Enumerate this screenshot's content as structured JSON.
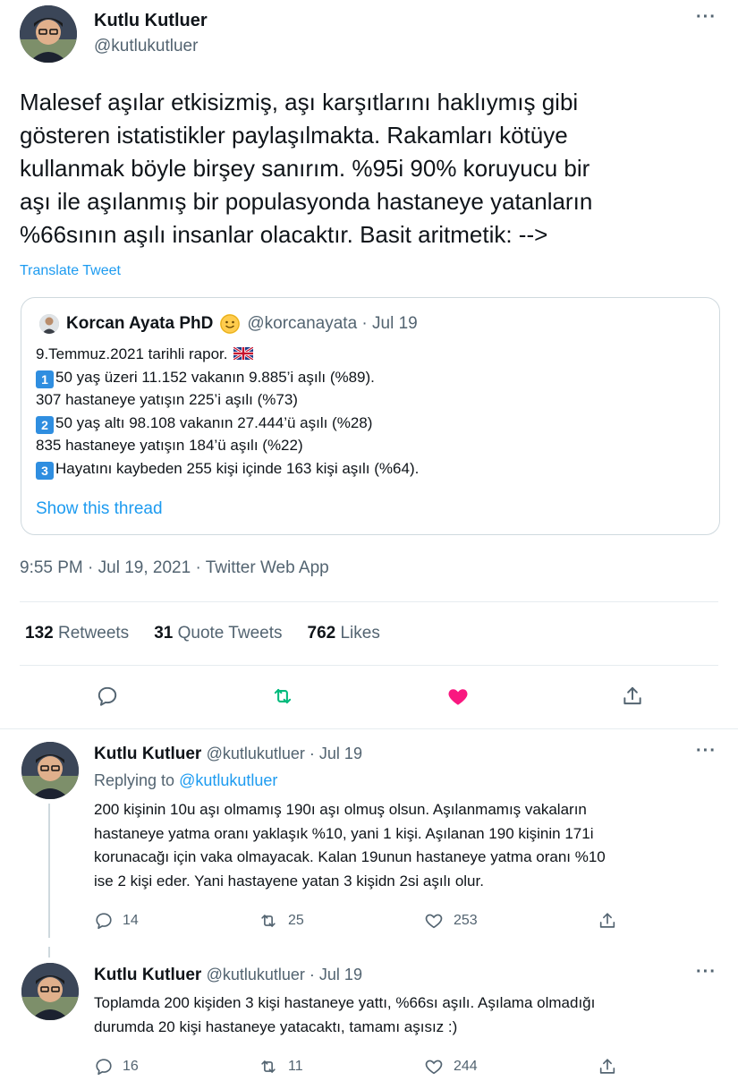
{
  "main_tweet": {
    "author_name": "Kutlu Kutluer",
    "author_handle": "@kutlukutluer",
    "more_label": "···",
    "text_lines": [
      "Malesef aşılar etkisizmiş, aşı karşıtlarını haklıymış gibi",
      "gösteren istatistikler paylaşılmakta. Rakamları kötüye",
      "kullanmak böyle birşey sanırım. %95i 90% koruyucu bir",
      "aşı ile aşılanmış bir populasyonda hastaneye yatanların",
      "%66sının aşılı insanlar olacaktır. Basit aritmetik: -->"
    ],
    "translate_label": "Translate Tweet",
    "timestamp": "9:55 PM · Jul 19, 2021 · Twitter Web App",
    "stats": {
      "retweets_count": "132",
      "retweets_label": "Retweets",
      "quotes_count": "31",
      "quotes_label": "Quote Tweets",
      "likes_count": "762",
      "likes_label": "Likes"
    }
  },
  "quoted_tweet": {
    "author_name": "Korcan Ayata PhD",
    "author_handle_date": "@korcanayata · Jul 19",
    "line1": "9.Temmuz.2021 tarihli rapor.",
    "badge1": "1",
    "line2": "50 yaş üzeri 11.152 vakanın 9.885’i aşılı (%89).",
    "line3": "307 hastaneye yatışın 225’i aşılı (%73)",
    "badge2": "2",
    "line4": "50 yaş altı 98.108 vakanın 27.444’ü aşılı (%28)",
    "line5": "835 hastaneye yatışın 184’ü aşılı (%22)",
    "badge3": "3",
    "line6": "Hayatını kaybeden 255 kişi içinde 163 kişi aşılı (%64).",
    "show_thread_label": "Show this thread"
  },
  "replies": [
    {
      "author_name": "Kutlu Kutluer",
      "handle_date": "@kutlukutluer · Jul 19",
      "replying_prefix": "Replying to",
      "replying_handle": "@kutlukutluer",
      "text_lines": [
        "200 kişinin 10u aşı olmamış 190ı aşı olmuş olsun. Aşılanmamış vakaların",
        "hastaneye yatma oranı yaklaşık %10, yani 1 kişi. Aşılanan 190 kişinin 171i",
        "korunacağı için vaka olmayacak. Kalan 19unun hastaneye yatma oranı %10",
        "ise 2 kişi eder. Yani hastayene yatan 3 kişidn 2si aşılı olur."
      ],
      "replies_count": "14",
      "retweets_count": "25",
      "likes_count": "253"
    },
    {
      "author_name": "Kutlu Kutluer",
      "handle_date": "@kutlukutluer · Jul 19",
      "text_lines": [
        "Toplamda 200 kişiden 3 kişi hastaneye yattı, %66sı aşılı. Aşılama olmadığı",
        "durumda 20 kişi hastaneye yatacaktı, tamamı aşısız :)"
      ],
      "replies_count": "16",
      "retweets_count": "11",
      "likes_count": "244"
    }
  ],
  "icons": {
    "reply": "reply-icon",
    "retweet": "retweet-icon",
    "like": "heart-icon",
    "share": "share-icon",
    "more": "more-icon"
  },
  "colors": {
    "accent": "#1d9bf0",
    "retweet": "#00ba7c",
    "like": "#f91880",
    "secondary_text": "#536471"
  }
}
